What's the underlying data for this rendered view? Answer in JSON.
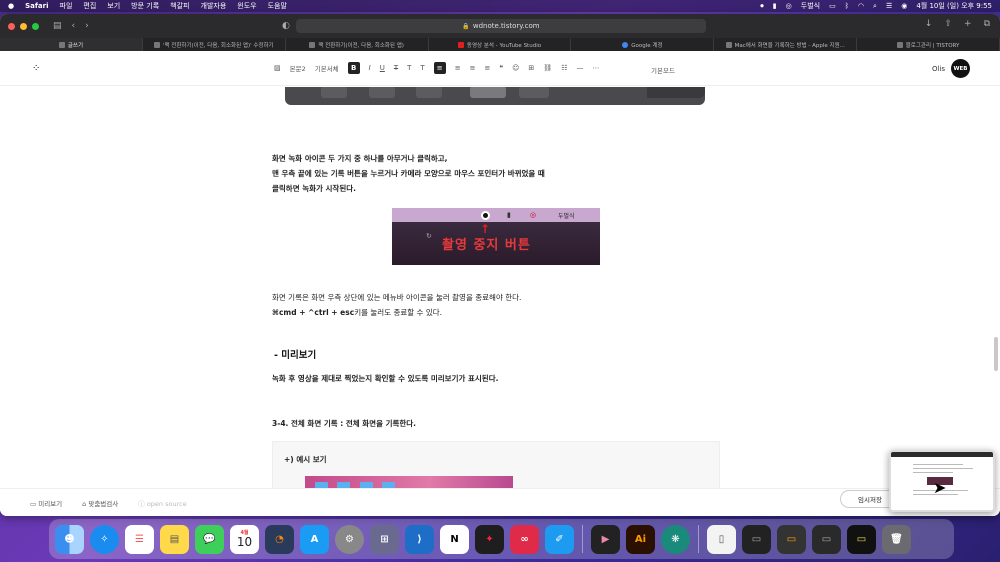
{
  "menubar": {
    "apple_icon": "apple-icon",
    "app_name": "Safari",
    "items": [
      "파일",
      "편집",
      "보기",
      "방문 기록",
      "책갈피",
      "개발자용",
      "윈도우",
      "도움말"
    ],
    "keyboard_label": "두벌식",
    "datetime": "4월 10일 (일) 오후 9:55"
  },
  "browser": {
    "url": "wdnote.tistory.com",
    "tabs": [
      {
        "label": "글쓰기",
        "active": true
      },
      {
        "label": "'맥 전환하기(이전, 다음, 회소화된 앱)' 수정하기",
        "active": false
      },
      {
        "label": "맥 전환하기(이전, 다음, 회소화된 앱)",
        "active": false
      },
      {
        "label": "동영상 분석 - YouTube Studio",
        "active": false
      },
      {
        "label": "Google 계정",
        "active": false
      },
      {
        "label": "Mac에서 화면을 기록하는 방법 - Apple 지원...",
        "active": false
      },
      {
        "label": "블로그관리 | TISTORY",
        "active": false
      }
    ]
  },
  "editor": {
    "logo": "⁘",
    "format_select": "본문2",
    "font_select": "기본서체",
    "mode_select": "기본모드",
    "user_name": "Olis",
    "avatar_text": "WEB"
  },
  "content": {
    "para1_line1": "화면 녹화 아이콘 두 가지 중 하나를 아무거나 클릭하고,",
    "para1_line2": "맨 우측 끝에 있는 기록 버튼을 누르거나 카메라 모양으로 마우스 포인터가 바뀌었을 때",
    "para1_line3": "클릭하면 녹화가 시작된다.",
    "screenshot_caption": "촬영 중지 버튼",
    "screenshot_menubar_label": "두벌식",
    "para2_line1": "화면 기록은 화면 우측 상단에 있는 메뉴바 아이콘을 눌러 촬영을 종료해야 한다.",
    "para2_line2_bold": "⌘cmd + ^ctrl + esc",
    "para2_line2_rest": "키를 눌러도 종료할 수 있다.",
    "preview_heading": "- 미리보기",
    "preview_text": "녹화 후 영상을 제대로 찍었는지 확인할 수 있도록 미리보기가 표시된다.",
    "section_heading": "3-4. 전체 화면 기록 : 전체 화면을 기록한다.",
    "example_label": "+) 예시 보기"
  },
  "footer": {
    "preview": "미리보기",
    "spellcheck": "맞춤법검사",
    "open_source": "open source",
    "save_temp": "임시저장"
  },
  "dock": {
    "calendar_month": "4월",
    "calendar_day": "10",
    "apps": [
      "Finder",
      "Safari",
      "Reminders",
      "Notes",
      "Messages",
      "Calendar",
      "Blender",
      "App Store",
      "System Preferences",
      "Launchpad",
      "VS Code",
      "Notion",
      "Figma",
      "Creative Cloud",
      "Twitter",
      "Final Cut Pro",
      "Illustrator",
      "Brain",
      "Trash"
    ]
  }
}
